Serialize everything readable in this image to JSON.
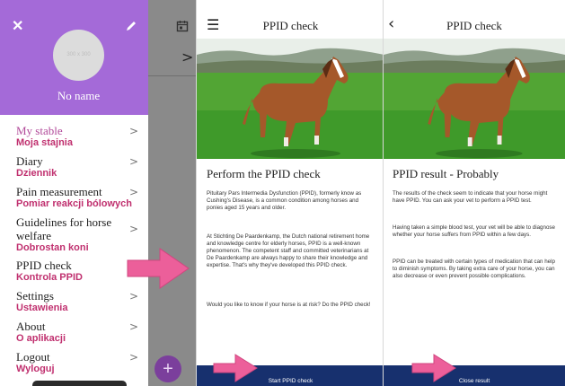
{
  "colors": {
    "drawer_header": "#a46ad8",
    "menu_polish_text": "#c0306f",
    "overlay_gray": "#7a7a7a",
    "fab_purple": "#7b3f9c",
    "bottom_bar_navy": "#17306e",
    "annotation_arrow_pink": "#ec5f9a"
  },
  "drawer": {
    "avatar_placeholder": "300 x 300",
    "user_name": "No name",
    "items": [
      {
        "en": "My stable",
        "pl": "Moja stajnia"
      },
      {
        "en": "Diary",
        "pl": "Dziennik"
      },
      {
        "en": "Pain measurement",
        "pl": "Pomiar reakcji bólowych"
      },
      {
        "en": "Guidelines for horse welfare",
        "pl": "Dobrostan koni"
      },
      {
        "en": "PPID check",
        "pl": "Kontrola PPID"
      },
      {
        "en": "Settings",
        "pl": "Ustawienia"
      },
      {
        "en": "About",
        "pl": "O aplikacji"
      },
      {
        "en": "Logout",
        "pl": "Wyloguj"
      }
    ],
    "chevron": ">"
  },
  "background": {
    "chevron": ">",
    "fab_label": "+"
  },
  "screen2": {
    "title": "PPID check",
    "heading": "Perform the PPID check",
    "paragraphs": [
      "Pituitary Pars Intermedia Dysfunction (PPID), formerly know as Cushing's Disease, is a common condition among horses and ponies aged 15 years and older.",
      "At Stichting De Paardenkamp, the Dutch national retirement home and knowledge centre for elderly horses, PPID is a well-known phenomenon. The competent staff and committed veterinarians at De Paardenkamp are always happy to share their knowledge and expertise. That's why they've developed this PPID check.",
      "Would  you like to know if your horse is at risk? Do the PPID check!"
    ],
    "button_label": "Start PPID check"
  },
  "screen3": {
    "title": "PPID check",
    "heading": "PPID result - Probably",
    "paragraphs": [
      "The results of the check seem to indicate that your horse might have PPID. You can ask your vet to perform a PPID test.",
      "Having taken a simple blood test, your vet will be able to diagnose whether your horse suffers from PPID within a few days.",
      "PPID can be treated with certain types of medication that can help to diminish symptoms. By taking extra care of your horse, you can also decrease or even prevent possible complications."
    ],
    "button_label": "Close result"
  }
}
